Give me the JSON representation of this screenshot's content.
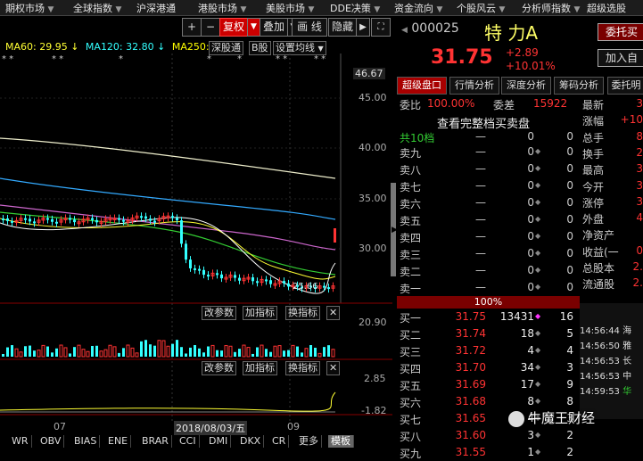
{
  "top_menu": [
    {
      "label": "期权市场"
    },
    {
      "label": "全球指数"
    },
    {
      "label": "沪深港通"
    },
    {
      "label": "港股市场"
    },
    {
      "label": "美股市场"
    },
    {
      "label": "DDE决策"
    },
    {
      "label": "资金流向"
    },
    {
      "label": "个股风云"
    },
    {
      "label": "分析师指数"
    },
    {
      "label": "超级选股"
    }
  ],
  "toolbar": {
    "plus": "+",
    "minus": "−",
    "fuquan": "复权",
    "fuquan_arrow": "▼",
    "diejia": "叠加",
    "diejia_arrow": "▼",
    "huaxian": "画 线",
    "yincang": "隐藏",
    "arrow": "▶"
  },
  "ma": {
    "ma60": "MA60: 29.95 ↓",
    "ma120": "MA120: 32.80 ↓",
    "ma250": "MA250: 3",
    "shengutong": "深股通",
    "bgu": "B股",
    "setting": "设置均线",
    "setting_arrow": "▼"
  },
  "colors": {
    "ma60": "#ffff33",
    "ma120": "#33ffff",
    "ma250": "#ffffff",
    "up": "#ff3333",
    "down": "#33ffff"
  },
  "price_axis": {
    "top": "46.67",
    "labels": [
      "45.00",
      "40.00",
      "35.00",
      "30.00"
    ],
    "low_label": "25.66"
  },
  "vol_panel": {
    "btns": [
      "改参数",
      "加指标",
      "换指标"
    ],
    "close": "✕",
    "label": "20.90"
  },
  "ind_panel": {
    "btns": [
      "改参数",
      "加指标",
      "换指标"
    ],
    "close": "✕",
    "top": "2.85",
    "bottom": "-1.82"
  },
  "date_axis": {
    "m07": "07",
    "m09": "09",
    "date": "2018/08/03/五"
  },
  "bottom_tabs": [
    "WR",
    "OBV",
    "BIAS",
    "ENE",
    "BRAR",
    "CCI",
    "DMI",
    "DKX",
    "CR",
    "更多",
    "模板"
  ],
  "right": {
    "code": "000025",
    "name": "特 力A",
    "weituo": "委托买",
    "jiaru": "加入自",
    "price": "31.75",
    "change": "+2.89",
    "pct": "+10.01%",
    "tabs": [
      "超级盘口",
      "行情分析",
      "深度分析",
      "筹码分析",
      "委托明"
    ],
    "weibi_label": "委比",
    "weibi": "100.00%",
    "weicha_label": "委差",
    "weicha": "15922",
    "full_order": "查看完整档买卖盘",
    "gong": "共10档",
    "sell": [
      {
        "lab": "卖九",
        "pr": "—",
        "vol": "0"
      },
      {
        "lab": "卖八",
        "pr": "—",
        "vol": "0"
      },
      {
        "lab": "卖七",
        "pr": "—",
        "vol": "0"
      },
      {
        "lab": "卖六",
        "pr": "—",
        "vol": "0"
      },
      {
        "lab": "卖五",
        "pr": "—",
        "vol": "0"
      },
      {
        "lab": "卖四",
        "pr": "—",
        "vol": "0"
      },
      {
        "lab": "卖三",
        "pr": "—",
        "vol": "0"
      },
      {
        "lab": "卖二",
        "pr": "—",
        "vol": "0"
      },
      {
        "lab": "卖一",
        "pr": "—",
        "vol": "0"
      }
    ],
    "sell_top": {
      "pr": "—",
      "vol": "0"
    },
    "bar_pct": "100%",
    "buy": [
      {
        "lab": "买一",
        "pr": "31.75",
        "vol": "13431",
        "cnt": "16"
      },
      {
        "lab": "买二",
        "pr": "31.74",
        "vol": "18",
        "cnt": "5"
      },
      {
        "lab": "买三",
        "pr": "31.72",
        "vol": "4",
        "cnt": "4"
      },
      {
        "lab": "买四",
        "pr": "31.70",
        "vol": "34",
        "cnt": "3"
      },
      {
        "lab": "买五",
        "pr": "31.69",
        "vol": "17",
        "cnt": "9"
      },
      {
        "lab": "买六",
        "pr": "31.68",
        "vol": "8",
        "cnt": "8"
      },
      {
        "lab": "买七",
        "pr": "31.65",
        "vol": "4",
        "cnt": "3"
      },
      {
        "lab": "买八",
        "pr": "31.60",
        "vol": "3",
        "cnt": "2"
      },
      {
        "lab": "买九",
        "pr": "31.55",
        "vol": "1",
        "cnt": "2"
      }
    ],
    "info": [
      {
        "l": "最新",
        "v": "3"
      },
      {
        "l": "涨幅",
        "v": "+10"
      },
      {
        "l": "总手",
        "v": "8"
      },
      {
        "l": "换手",
        "v": "2"
      },
      {
        "l": "最高",
        "v": "3"
      },
      {
        "l": "今开",
        "v": "3"
      },
      {
        "l": "涨停",
        "v": "3"
      },
      {
        "l": "外盘",
        "v": "4"
      },
      {
        "l": "净资产",
        "v": ""
      },
      {
        "l": "收益(一",
        "v": "0"
      },
      {
        "l": "总股本",
        "v": "2."
      },
      {
        "l": "流通股",
        "v": "2."
      }
    ],
    "ticks": [
      {
        "t": "14:56:44",
        "n": "海"
      },
      {
        "t": "14:56:50",
        "n": "雅"
      },
      {
        "t": "14:56:53",
        "n": "长"
      },
      {
        "t": "14:56:53",
        "n": "中"
      },
      {
        "t": "14:59:53",
        "n": "华"
      }
    ]
  },
  "watermark": "牛魔王财经"
}
